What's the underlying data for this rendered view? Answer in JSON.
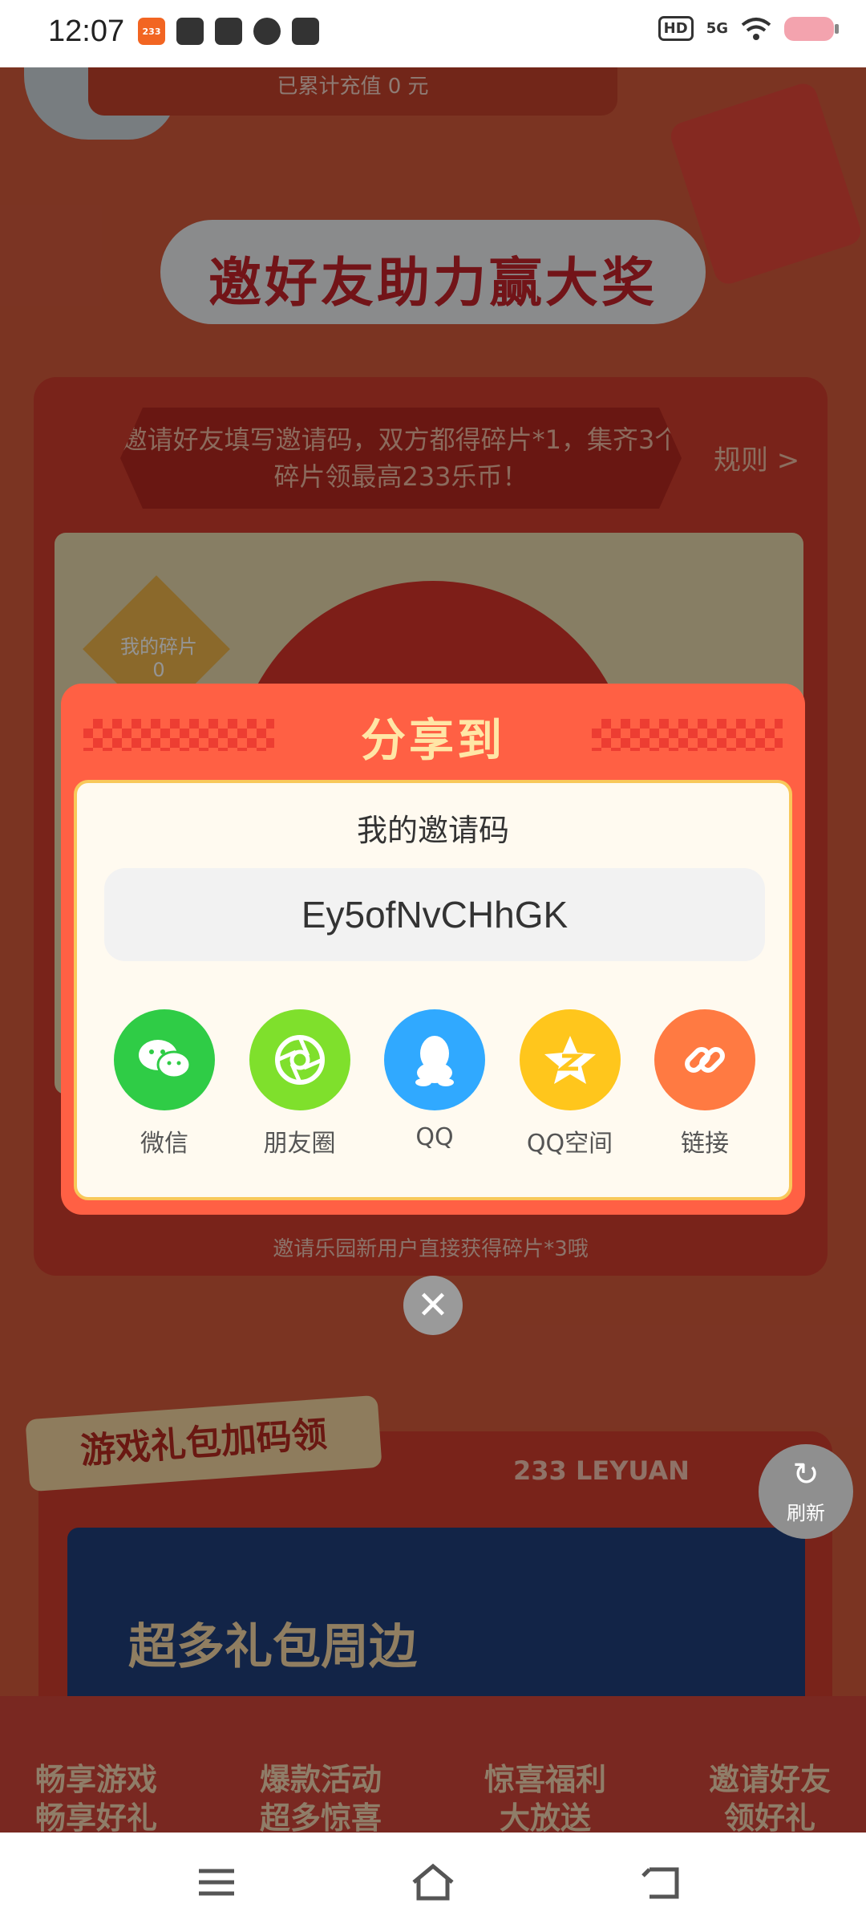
{
  "status_bar": {
    "time": "12:07",
    "app_badge": "233",
    "hd": "HD",
    "signal": "5G"
  },
  "page": {
    "recharge_total": "已累计充值 0 元",
    "headline": "邀好友助力赢大奖",
    "invite_banner": "邀请好友填写邀请码，双方都得碎片*1，集齐3个碎片领最高233乐币！",
    "rules_link": "规则 >",
    "watermark": "233 LEYUAN",
    "my_fragments": "我的碎片",
    "fragment_count": "0",
    "footer_note": "邀请乐园新用户直接获得碎片*3哦",
    "gift_tag": "游戏礼包加码领",
    "leyuan_label": "233 LEYUAN",
    "gift_banner_text": "超多礼包周边",
    "refresh_label": "刷新",
    "features": [
      {
        "line1": "畅享游戏",
        "line2": "畅享好礼"
      },
      {
        "line1": "爆款活动",
        "line2": "超多惊喜"
      },
      {
        "line1": "惊喜福利",
        "line2": "大放送"
      },
      {
        "line1": "邀请好友",
        "line2": "领好礼"
      }
    ]
  },
  "modal": {
    "title": "分享到",
    "code_label": "我的邀请码",
    "invite_code": "Ey5ofNvCHhGK",
    "share_targets": [
      {
        "label": "微信",
        "color": "#2fcc46",
        "icon": "wechat-icon"
      },
      {
        "label": "朋友圈",
        "color": "#7fe02c",
        "icon": "moments-icon"
      },
      {
        "label": "QQ",
        "color": "#30a9ff",
        "icon": "qq-icon"
      },
      {
        "label": "QQ空间",
        "color": "#ffc61c",
        "icon": "qzone-icon"
      },
      {
        "label": "链接",
        "color": "#ff7a42",
        "icon": "link-icon"
      }
    ],
    "close_symbol": "✕"
  }
}
